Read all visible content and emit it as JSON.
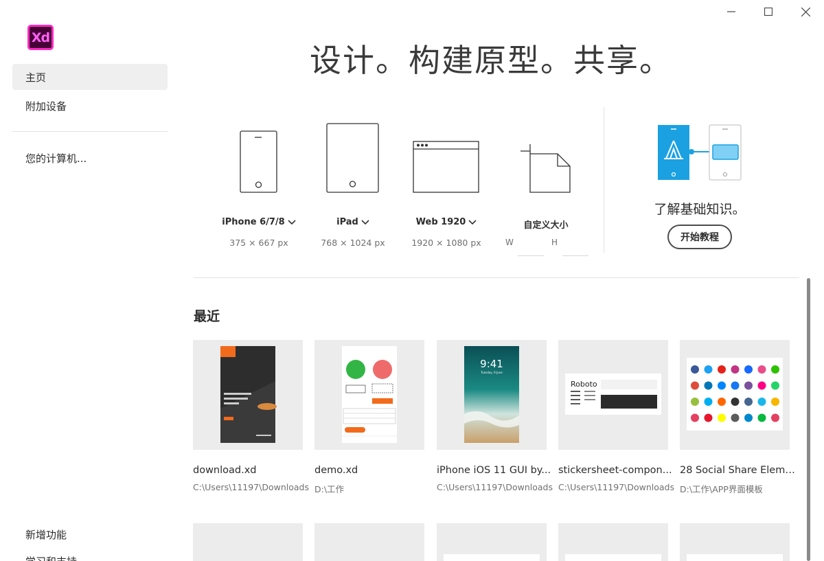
{
  "app": {
    "logo_text": "Xd",
    "brand_color": "#ff2bc2"
  },
  "sidebar": {
    "items": [
      {
        "label": "主页",
        "active": true
      },
      {
        "label": "附加设备"
      },
      {
        "label": "您的计算机..."
      }
    ],
    "bottom_items": [
      {
        "label": "新增功能"
      },
      {
        "label": "学习和支持"
      }
    ]
  },
  "headline": "设计。构建原型。共享。",
  "presets": [
    {
      "name": "iPhone 6/7/8",
      "size": "375 × 667 px",
      "icon": "phone-icon"
    },
    {
      "name": "iPad",
      "size": "768 × 1024 px",
      "icon": "tablet-icon"
    },
    {
      "name": "Web 1920",
      "size": "1920 × 1080 px",
      "icon": "browser-icon"
    },
    {
      "name": "自定义大小",
      "icon": "custom-size-icon",
      "w_label": "W",
      "h_label": "H"
    }
  ],
  "learn": {
    "text": "了解基础知识。",
    "button": "开始教程"
  },
  "recent": {
    "title": "最近",
    "files": [
      {
        "name": "download.xd",
        "path": "C:\\Users\\11197\\Downloads"
      },
      {
        "name": "demo.xd",
        "path": "D:\\工作"
      },
      {
        "name": "iPhone iOS 11 GUI by...",
        "path": "C:\\Users\\11197\\Downloads",
        "thumb_time": "9:41",
        "thumb_date": "Tuesday, 9 June"
      },
      {
        "name": "stickersheet-compon...",
        "path": "C:\\Users\\11197\\Downloads",
        "thumb_title": "Roboto"
      },
      {
        "name": "28 Social Share Eleme...",
        "path": "D:\\工作\\APP界面模板"
      }
    ]
  },
  "colors": {
    "accent_blue": "#1ba1e2",
    "tutorial_box": "#80d0f5"
  }
}
